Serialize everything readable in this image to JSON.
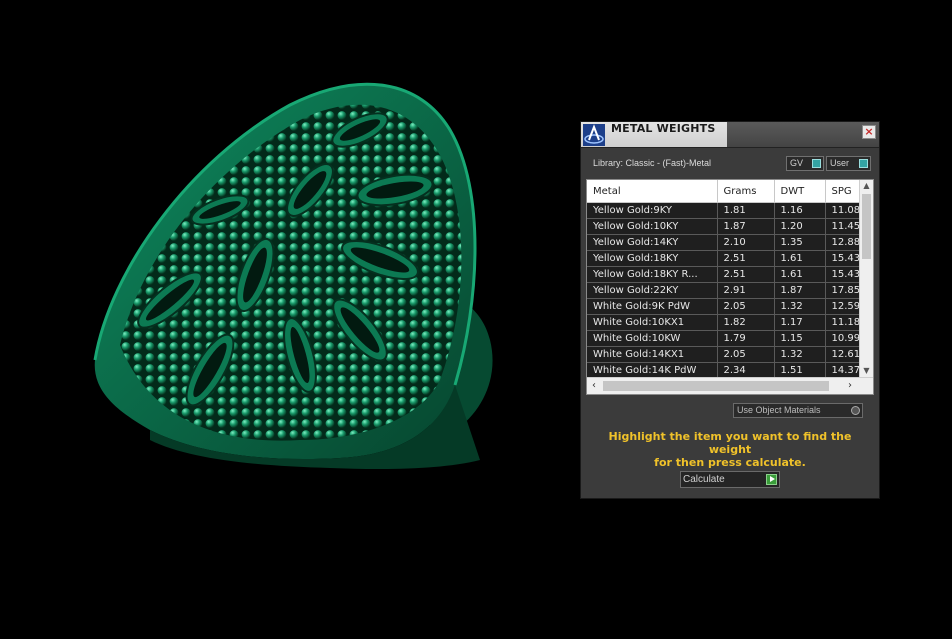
{
  "panel": {
    "title": "METAL WEIGHTS",
    "close_symbol": "×",
    "library_label": "Library: Classic - (Fast)-Metal",
    "toggle_gv": "GV",
    "toggle_user": "User",
    "columns": [
      "Metal",
      "Grams",
      "DWT",
      "SPG"
    ],
    "rows": [
      [
        "Yellow Gold:9KY",
        "1.81",
        "1.16",
        "11.08"
      ],
      [
        "Yellow Gold:10KY",
        "1.87",
        "1.20",
        "11.45"
      ],
      [
        "Yellow Gold:14KY",
        "2.10",
        "1.35",
        "12.88"
      ],
      [
        "Yellow Gold:18KY",
        "2.51",
        "1.61",
        "15.43"
      ],
      [
        "Yellow Gold:18KY R...",
        "2.51",
        "1.61",
        "15.43"
      ],
      [
        "Yellow Gold:22KY",
        "2.91",
        "1.87",
        "17.85"
      ],
      [
        "White Gold:9K PdW",
        "2.05",
        "1.32",
        "12.59"
      ],
      [
        "White Gold:10KX1",
        "1.82",
        "1.17",
        "11.18"
      ],
      [
        "White Gold:10KW",
        "1.79",
        "1.15",
        "10.99"
      ],
      [
        "White Gold:14KX1",
        "2.05",
        "1.32",
        "12.61"
      ],
      [
        "White Gold:14K PdW",
        "2.34",
        "1.51",
        "14.37"
      ]
    ],
    "use_object_materials": "Use Object Materials",
    "hint_line1": "Highlight the item you want to find the weight",
    "hint_line2": "for then press calculate.",
    "calculate_label": "Calculate"
  },
  "icons": {
    "app_logo": "app-logo-icon",
    "close": "close-icon",
    "scroll_up": "chevron-up-icon",
    "scroll_down": "chevron-down-icon",
    "scroll_left": "chevron-left-icon",
    "scroll_right": "chevron-right-icon",
    "calculate": "play-icon"
  },
  "colors": {
    "model_green": "#0f8a5f",
    "hint_yellow": "#f0c22a",
    "panel_bg": "#3b3b3b"
  }
}
